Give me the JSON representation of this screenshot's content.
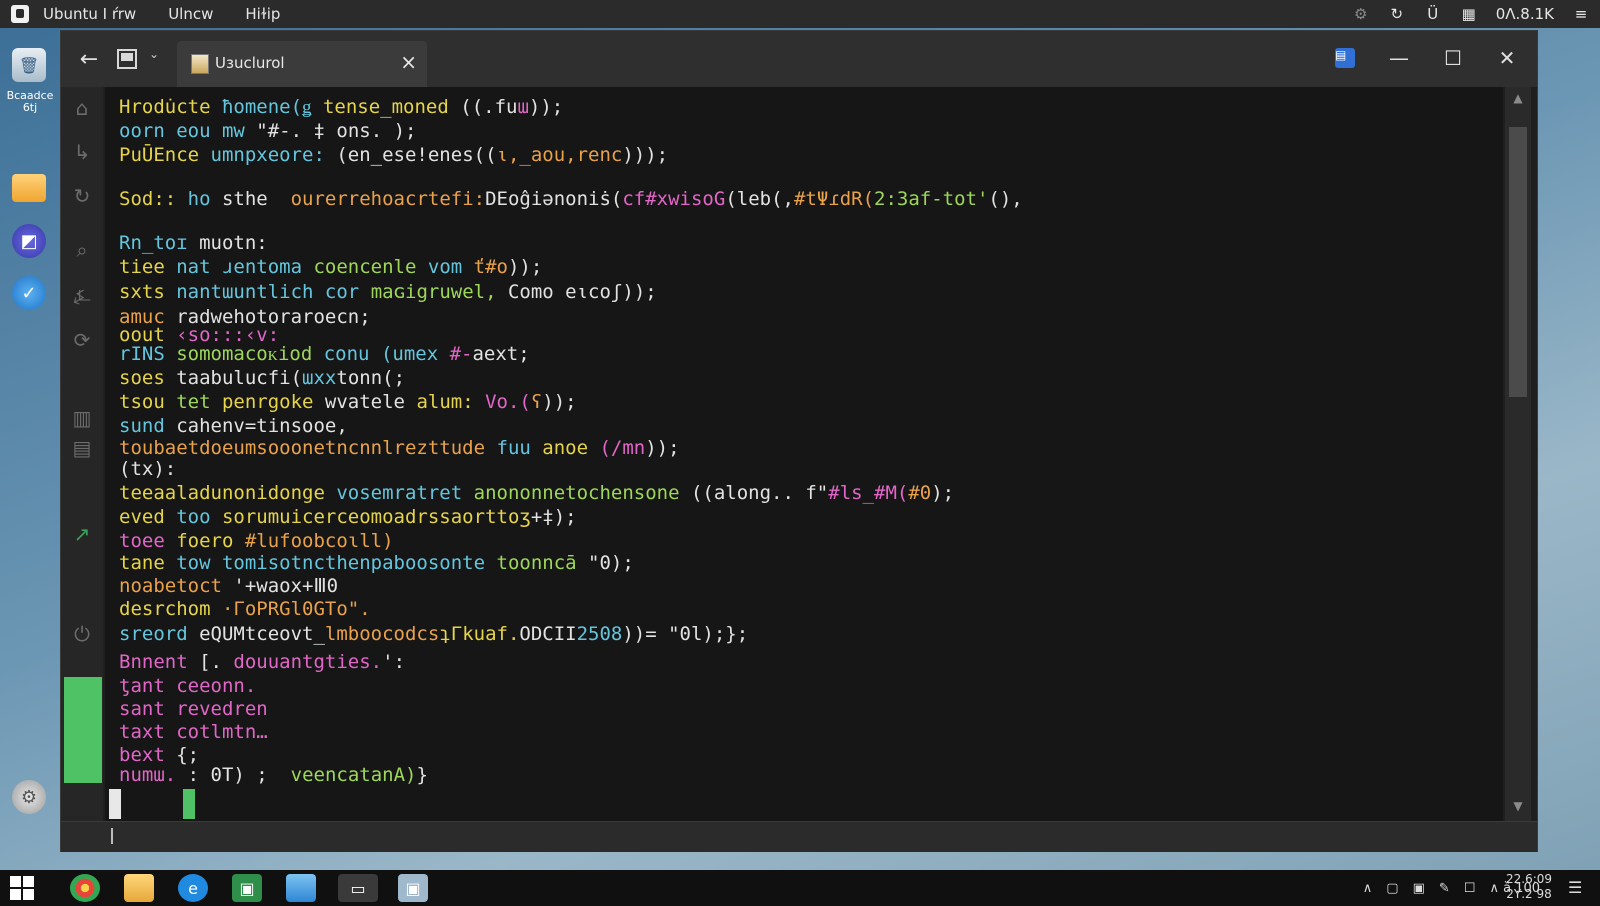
{
  "system_bar": {
    "menus": [
      "Ubuntu Ι ŕrw",
      "Ulncw",
      "Hiɫip"
    ],
    "status_text": "0Λ.8.1Κ"
  },
  "dock": {
    "trash_label": "Bcaadce 6tj"
  },
  "window": {
    "tab_title": "Uɜuclurol"
  },
  "terminal": {
    "lines": [
      [
        {
          "t": "Hrodu̇cte ",
          "c": "y"
        },
        {
          "t": "ħomene(ǥ ",
          "c": "c"
        },
        {
          "t": "tense_moned ",
          "c": "y"
        },
        {
          "t": "((.fu",
          "c": "w"
        },
        {
          "t": "ɯ",
          "c": "p"
        },
        {
          "t": "));",
          "c": "w"
        }
      ],
      [
        {
          "t": "oorn ",
          "c": "c"
        },
        {
          "t": "eou ",
          "c": "c"
        },
        {
          "t": "mw ",
          "c": "c"
        },
        {
          "t": "\"#-. ‡ ",
          "c": "w"
        },
        {
          "t": "ons.",
          "c": "w"
        },
        {
          "t": " );",
          "c": "w"
        }
      ],
      [
        {
          "t": "PuŪEnce ",
          "c": "y"
        },
        {
          "t": "umnpxeore: ",
          "c": "c"
        },
        {
          "t": "(en_ese!enes((",
          "c": "w"
        },
        {
          "t": "ι,_aou,renc",
          "c": "o"
        },
        {
          "t": ")));",
          "c": "w"
        }
      ],
      [],
      [
        {
          "t": "Sod:: ",
          "c": "y"
        },
        {
          "t": "ho ",
          "c": "c"
        },
        {
          "t": "sthe  ",
          "c": "w"
        },
        {
          "t": "ourerrehoacrtefi:",
          "c": "o"
        },
        {
          "t": "DЕoĝiǝnoniṡ(",
          "c": "w"
        },
        {
          "t": "cf#xwisoG",
          "c": "p"
        },
        {
          "t": "(leb(,",
          "c": "w"
        },
        {
          "t": "#tΨɾdR(",
          "c": "o"
        },
        {
          "t": "2:3af-tot'",
          "c": "g"
        },
        {
          "t": "(),",
          "c": "w"
        }
      ],
      [],
      [
        {
          "t": "Rn_toɪ ",
          "c": "c"
        },
        {
          "t": "muotn:",
          "c": "w"
        }
      ],
      [
        {
          "t": "tiee ",
          "c": "y"
        },
        {
          "t": "nat ",
          "c": "c"
        },
        {
          "t": "ɹentoma ",
          "c": "c"
        },
        {
          "t": "coencenle ",
          "c": "g"
        },
        {
          "t": "vom ",
          "c": "c"
        },
        {
          "t": "ť#o",
          "c": "o"
        },
        {
          "t": "));",
          "c": "w"
        }
      ],
      [
        {
          "t": "sxts ",
          "c": "y"
        },
        {
          "t": "nantɯuntlich ",
          "c": "c"
        },
        {
          "t": "cor ",
          "c": "c"
        },
        {
          "t": "maɢigruwel, ",
          "c": "g"
        },
        {
          "t": "Como ",
          "c": "w"
        },
        {
          "t": "eιcoʃ",
          "c": "w"
        },
        {
          "t": "));",
          "c": "w"
        }
      ],
      [
        {
          "t": "amuc ",
          "c": "o"
        },
        {
          "t": "radwehotoraroecn;",
          "c": "w"
        }
      ],
      [
        {
          "t": "oout ",
          "c": "y"
        },
        {
          "t": "‹so:::‹v:",
          "c": "p"
        }
      ],
      [
        {
          "t": "rINS ",
          "c": "c"
        },
        {
          "t": "somomacoᴋiod ",
          "c": "g"
        },
        {
          "t": "conu ",
          "c": "c"
        },
        {
          "t": "(umex ",
          "c": "c"
        },
        {
          "t": "#-",
          "c": "p"
        },
        {
          "t": "aext;",
          "c": "w"
        }
      ],
      [
        {
          "t": "soes ",
          "c": "y"
        },
        {
          "t": "taabulucfi(",
          "c": "w"
        },
        {
          "t": "ɯxx",
          "c": "c"
        },
        {
          "t": "tonn(;",
          "c": "w"
        }
      ],
      [
        {
          "t": "tsou ",
          "c": "y"
        },
        {
          "t": "tet ",
          "c": "g"
        },
        {
          "t": "penrgoke ",
          "c": "y"
        },
        {
          "t": "wvatele ",
          "c": "w"
        },
        {
          "t": "alum: ",
          "c": "y"
        },
        {
          "t": "Vo.(",
          "c": "p"
        },
        {
          "t": "ʕ",
          "c": "o"
        },
        {
          "t": "));",
          "c": "w"
        }
      ],
      [
        {
          "t": "sund ",
          "c": "c"
        },
        {
          "t": "cahenv=tinsooe,",
          "c": "w"
        }
      ],
      [
        {
          "t": "toubaetdoeumsooonetncnnlrezttude ",
          "c": "o"
        },
        {
          "t": "fuu ",
          "c": "c"
        },
        {
          "t": "anoe ",
          "c": "y"
        },
        {
          "t": "(/mn",
          "c": "p"
        },
        {
          "t": "));",
          "c": "w"
        }
      ],
      [
        {
          "t": "(tx):",
          "c": "w"
        }
      ],
      [
        {
          "t": "teeaaladunonidonge ",
          "c": "y"
        },
        {
          "t": "vosemratret ",
          "c": "c"
        },
        {
          "t": "anononnetochensone ",
          "c": "g"
        },
        {
          "t": "((along.. ",
          "c": "w"
        },
        {
          "t": "f\"",
          "c": "w"
        },
        {
          "t": "#ls_#M(",
          "c": "p"
        },
        {
          "t": "#0",
          "c": "o"
        },
        {
          "t": ");",
          "c": "w"
        }
      ],
      [
        {
          "t": "eved ",
          "c": "y"
        },
        {
          "t": "too ",
          "c": "c"
        },
        {
          "t": "sorumuicerceomoadrssaorttoʒ",
          "c": "y"
        },
        {
          "t": "+‡);",
          "c": "w"
        }
      ],
      [
        {
          "t": "toee ",
          "c": "p"
        },
        {
          "t": "foero ",
          "c": "y"
        },
        {
          "t": "#lufoobcoɩll)",
          "c": "o"
        }
      ],
      [
        {
          "t": "tane ",
          "c": "y"
        },
        {
          "t": "tow ",
          "c": "c"
        },
        {
          "t": "tomisotncthenpaboosonte ",
          "c": "c"
        },
        {
          "t": "toonncā ",
          "c": "g"
        },
        {
          "t": "\"0);",
          "c": "w"
        }
      ],
      [
        {
          "t": "noabetoct ",
          "c": "o"
        },
        {
          "t": "'+waox+Ⅲ0",
          "c": "w"
        }
      ],
      [
        {
          "t": "desrchom ",
          "c": "y"
        },
        {
          "t": "·ΓoPRGl0GTo\".",
          "c": "o"
        }
      ],
      [
        {
          "t": "sreord ",
          "c": "c"
        },
        {
          "t": "eQUMtceovt_",
          "c": "w"
        },
        {
          "t": "lmboocodcs",
          "c": "o"
        },
        {
          "t": "ʇΓkuaf.",
          "c": "y"
        },
        {
          "t": "ODCII",
          "c": "w"
        },
        {
          "t": "2508",
          "c": "c"
        },
        {
          "t": "))= \"0l);};",
          "c": "w"
        }
      ],
      [
        {
          "t": "Bnnent ",
          "c": "p"
        },
        {
          "t": "[. ",
          "c": "w"
        },
        {
          "t": "douuantgties.",
          "c": "p"
        },
        {
          "t": "':",
          "c": "w"
        }
      ],
      [
        {
          "t": "ƫant ",
          "c": "p"
        },
        {
          "t": "ceeonn.",
          "c": "p"
        }
      ],
      [
        {
          "t": "sant ",
          "c": "p"
        },
        {
          "t": "revedren",
          "c": "p"
        }
      ],
      [
        {
          "t": "taxt ",
          "c": "p"
        },
        {
          "t": "cotlmtn…",
          "c": "p"
        }
      ],
      [
        {
          "t": "bext ",
          "c": "p"
        },
        {
          "t": "{;",
          "c": "w"
        }
      ],
      [
        {
          "t": "numɯ. ",
          "c": "p"
        },
        {
          "t": ": ",
          "c": "w"
        },
        {
          "t": "0T) ",
          "c": "w"
        },
        {
          "t": ";  ",
          "c": "w"
        },
        {
          "t": "veencatanA)",
          "c": "g"
        },
        {
          "t": "}",
          "c": "w"
        }
      ]
    ]
  },
  "taskbar": {
    "tray_text": "∧ ȁ 100",
    "clock_time": "22.6:09",
    "clock_date": "2Υ.2 98"
  },
  "colors": {
    "yellow": "#e6d44a",
    "cyan": "#64c6de",
    "orange": "#eaa24a",
    "white": "#e2e2e2",
    "pink": "#e266c8",
    "green": "#9ed75a",
    "accent_green": "#4fc265"
  }
}
